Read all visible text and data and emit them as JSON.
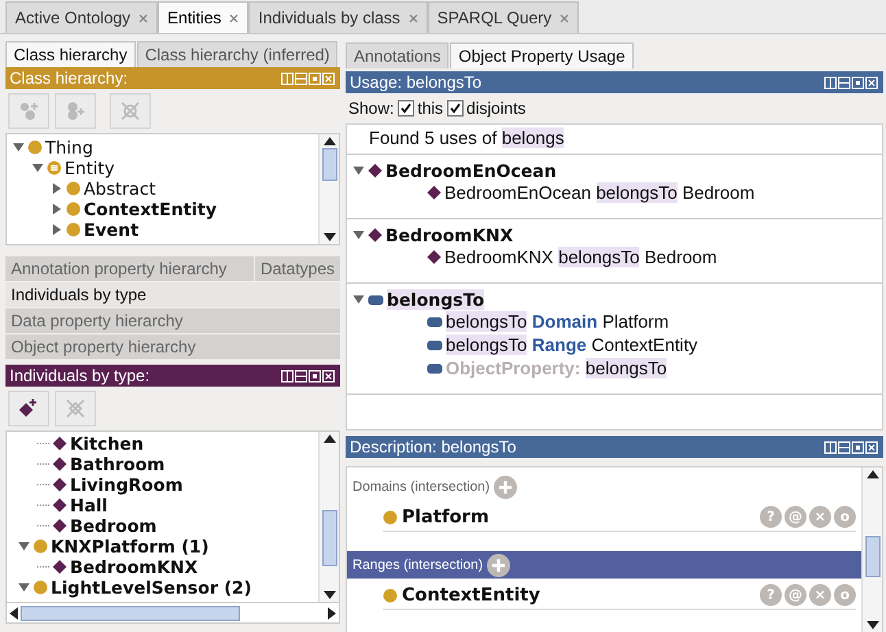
{
  "tabs": [
    {
      "label": "Active Ontology",
      "selected": false,
      "closable": true
    },
    {
      "label": "Entities",
      "selected": true,
      "closable": true
    },
    {
      "label": "Individuals by class",
      "selected": false,
      "closable": true
    },
    {
      "label": "SPARQL Query",
      "selected": false,
      "closable": true
    }
  ],
  "class_tabs": [
    {
      "label": "Class hierarchy",
      "selected": true
    },
    {
      "label": "Class hierarchy (inferred)",
      "selected": false
    }
  ],
  "class_hierarchy": {
    "title": "Class hierarchy:",
    "tree": [
      {
        "label": "Thing",
        "kind": "class",
        "bold": false,
        "expanded": true,
        "children": [
          {
            "label": "Entity",
            "kind": "defined",
            "bold": false,
            "expanded": true,
            "children": [
              {
                "label": "Abstract",
                "kind": "class",
                "bold": false,
                "expanded": false
              },
              {
                "label": "ContextEntity",
                "kind": "class",
                "bold": true,
                "expanded": false
              },
              {
                "label": "Event",
                "kind": "class",
                "bold": true,
                "expanded": false
              }
            ]
          }
        ]
      }
    ]
  },
  "hierarchy_tabs": [
    {
      "tabs": [
        {
          "label": "Annotation property hierarchy",
          "selected": false
        },
        {
          "label": "Datatypes",
          "selected": false
        }
      ]
    },
    {
      "tabs": [
        {
          "label": "Individuals by type",
          "selected": true
        }
      ]
    },
    {
      "tabs": [
        {
          "label": "Data property hierarchy",
          "selected": false
        }
      ]
    },
    {
      "tabs": [
        {
          "label": "Object property hierarchy",
          "selected": false
        }
      ]
    }
  ],
  "individuals": {
    "title": "Individuals by type:",
    "tree": [
      {
        "label": "Kitchen",
        "kind": "individual",
        "bold": true
      },
      {
        "label": "Bathroom",
        "kind": "individual",
        "bold": true
      },
      {
        "label": "LivingRoom",
        "kind": "individual",
        "bold": true
      },
      {
        "label": "Hall",
        "kind": "individual",
        "bold": true
      },
      {
        "label": "Bedroom",
        "kind": "individual",
        "bold": true
      },
      {
        "label": "KNXPlatform (1)",
        "kind": "class",
        "bold": true,
        "expanded": true,
        "root": true,
        "children": [
          {
            "label": "BedroomKNX",
            "kind": "individual",
            "bold": true
          }
        ]
      },
      {
        "label": "LightLevelSensor (2)",
        "kind": "class",
        "bold": true,
        "expanded": true,
        "root": true
      }
    ]
  },
  "right_tabs": [
    {
      "label": "Annotations",
      "selected": false
    },
    {
      "label": "Object Property Usage",
      "selected": true
    }
  ],
  "usage": {
    "title": "Usage: belongsTo",
    "show_label": "Show:",
    "options": [
      {
        "label": "this",
        "checked": true
      },
      {
        "label": "disjoints",
        "checked": true
      }
    ],
    "found": [
      {
        "text": "Found 5 uses of ",
        "kind": "plain"
      },
      {
        "text": "belongs",
        "kind": "highlight"
      }
    ],
    "groups": [
      {
        "kind": "individual",
        "expanded": true,
        "title": [
          {
            "text": "BedroomEnOcean",
            "kind": "plain"
          }
        ],
        "items": [
          {
            "kind": "individual",
            "segments": [
              {
                "text": "BedroomEnOcean ",
                "kind": "plain"
              },
              {
                "text": "belongsTo",
                "kind": "highlight"
              },
              {
                "text": " Bedroom",
                "kind": "plain"
              }
            ]
          }
        ]
      },
      {
        "kind": "individual",
        "expanded": true,
        "title": [
          {
            "text": "BedroomKNX",
            "kind": "plain"
          }
        ],
        "items": [
          {
            "kind": "individual",
            "segments": [
              {
                "text": "BedroomKNX ",
                "kind": "plain"
              },
              {
                "text": "belongsTo",
                "kind": "highlight"
              },
              {
                "text": " Bedroom",
                "kind": "plain"
              }
            ]
          }
        ]
      },
      {
        "kind": "property",
        "expanded": true,
        "title": [
          {
            "text": "belongsTo",
            "kind": "highlight"
          }
        ],
        "items": [
          {
            "kind": "property",
            "segments": [
              {
                "text": "belongsTo",
                "kind": "highlight"
              },
              {
                "text": " Domain",
                "kind": "keyword"
              },
              {
                "text": " Platform",
                "kind": "plain"
              }
            ]
          },
          {
            "kind": "property",
            "segments": [
              {
                "text": "belongsTo",
                "kind": "highlight"
              },
              {
                "text": " Range",
                "kind": "keyword"
              },
              {
                "text": " ContextEntity",
                "kind": "plain"
              }
            ]
          },
          {
            "kind": "property",
            "segments": [
              {
                "text": "ObjectProperty: ",
                "kind": "muted"
              },
              {
                "text": "belongsTo",
                "kind": "highlight"
              }
            ]
          }
        ]
      }
    ]
  },
  "description": {
    "title": "Description: belongsTo",
    "sections": [
      {
        "label": "Domains (intersection)",
        "selected": false,
        "items": [
          {
            "label": "Platform",
            "actions": [
              "?",
              "@",
              "×",
              "o"
            ]
          }
        ]
      },
      {
        "label": "Ranges (intersection)",
        "selected": true,
        "items": [
          {
            "label": "ContextEntity",
            "actions": [
              "?",
              "@",
              "×",
              "o"
            ]
          }
        ]
      }
    ]
  }
}
